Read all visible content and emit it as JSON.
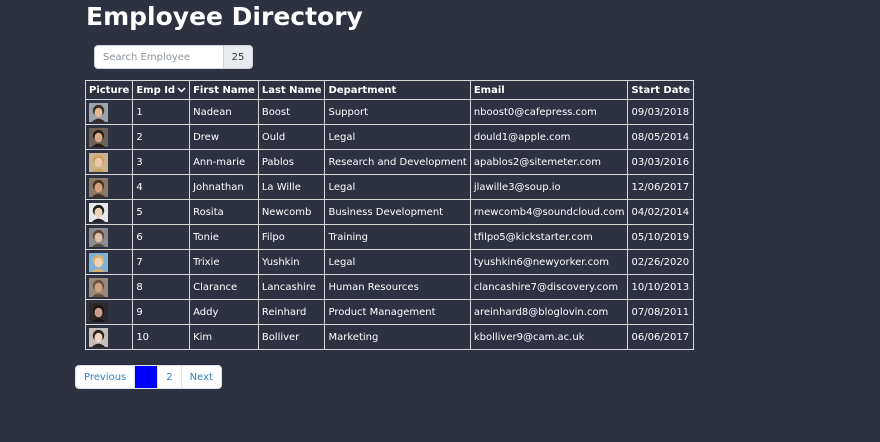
{
  "header": {
    "title": "Employee Directory"
  },
  "search": {
    "placeholder": "Search Employee",
    "page_size": "25"
  },
  "table": {
    "columns": [
      "Picture",
      "Emp Id",
      "First Name",
      "Last Name",
      "Department",
      "Email",
      "Start Date"
    ],
    "rows": [
      {
        "emp_id": "1",
        "first_name": "Nadean",
        "last_name": "Boost",
        "department": "Support",
        "email": "nboost0@cafepress.com",
        "start_date": "09/03/2018"
      },
      {
        "emp_id": "2",
        "first_name": "Drew",
        "last_name": "Ould",
        "department": "Legal",
        "email": "dould1@apple.com",
        "start_date": "08/05/2014"
      },
      {
        "emp_id": "3",
        "first_name": "Ann-marie",
        "last_name": "Pablos",
        "department": "Research and Development",
        "email": "apablos2@sitemeter.com",
        "start_date": "03/03/2016"
      },
      {
        "emp_id": "4",
        "first_name": "Johnathan",
        "last_name": "La Wille",
        "department": "Legal",
        "email": "jlawille3@soup.io",
        "start_date": "12/06/2017"
      },
      {
        "emp_id": "5",
        "first_name": "Rosita",
        "last_name": "Newcomb",
        "department": "Business Development",
        "email": "rnewcomb4@soundcloud.com",
        "start_date": "04/02/2014"
      },
      {
        "emp_id": "6",
        "first_name": "Tonie",
        "last_name": "Filpo",
        "department": "Training",
        "email": "tfilpo5@kickstarter.com",
        "start_date": "05/10/2019"
      },
      {
        "emp_id": "7",
        "first_name": "Trixie",
        "last_name": "Yushkin",
        "department": "Legal",
        "email": "tyushkin6@newyorker.com",
        "start_date": "02/26/2020"
      },
      {
        "emp_id": "8",
        "first_name": "Clarance",
        "last_name": "Lancashire",
        "department": "Human Resources",
        "email": "clancashire7@discovery.com",
        "start_date": "10/10/2013"
      },
      {
        "emp_id": "9",
        "first_name": "Addy",
        "last_name": "Reinhard",
        "department": "Product Management",
        "email": "areinhard8@bloglovin.com",
        "start_date": "07/08/2011"
      },
      {
        "emp_id": "10",
        "first_name": "Kim",
        "last_name": "Bolliver",
        "department": "Marketing",
        "email": "kbolliver9@cam.ac.uk",
        "start_date": "06/06/2017"
      }
    ]
  },
  "pagination": {
    "previous": "Previous",
    "current": "",
    "page2": "2",
    "next": "Next"
  },
  "colors": {
    "background": "#2e3140",
    "text": "#ffffff",
    "link": "#2f7fc1",
    "active_page": "#0000ff",
    "border": "#d8d8d8"
  },
  "avatars": [
    {
      "bg": "#9aa4ae",
      "skin": "#e2b899",
      "hair": "#3a2a20"
    },
    {
      "bg": "#6f6358",
      "skin": "#d9a98a",
      "hair": "#2a1e17"
    },
    {
      "bg": "#c9b48f",
      "skin": "#ecc9a5",
      "hair": "#c8a060"
    },
    {
      "bg": "#8b7a68",
      "skin": "#d6a27e",
      "hair": "#4a3222"
    },
    {
      "bg": "#e8e8e8",
      "skin": "#f0d3bd",
      "hair": "#222222"
    },
    {
      "bg": "#8c8c8c",
      "skin": "#e0c0a4",
      "hair": "#5a4a3a"
    },
    {
      "bg": "#7fb3d5",
      "skin": "#f2d2b3",
      "hair": "#d9b070"
    },
    {
      "bg": "#9a8a7a",
      "skin": "#d1a07d",
      "hair": "#6a5040"
    },
    {
      "bg": "#2f2a2a",
      "skin": "#caa08a",
      "hair": "#1a1414"
    },
    {
      "bg": "#c8c0b8",
      "skin": "#f0d6c2",
      "hair": "#2a2020"
    }
  ]
}
